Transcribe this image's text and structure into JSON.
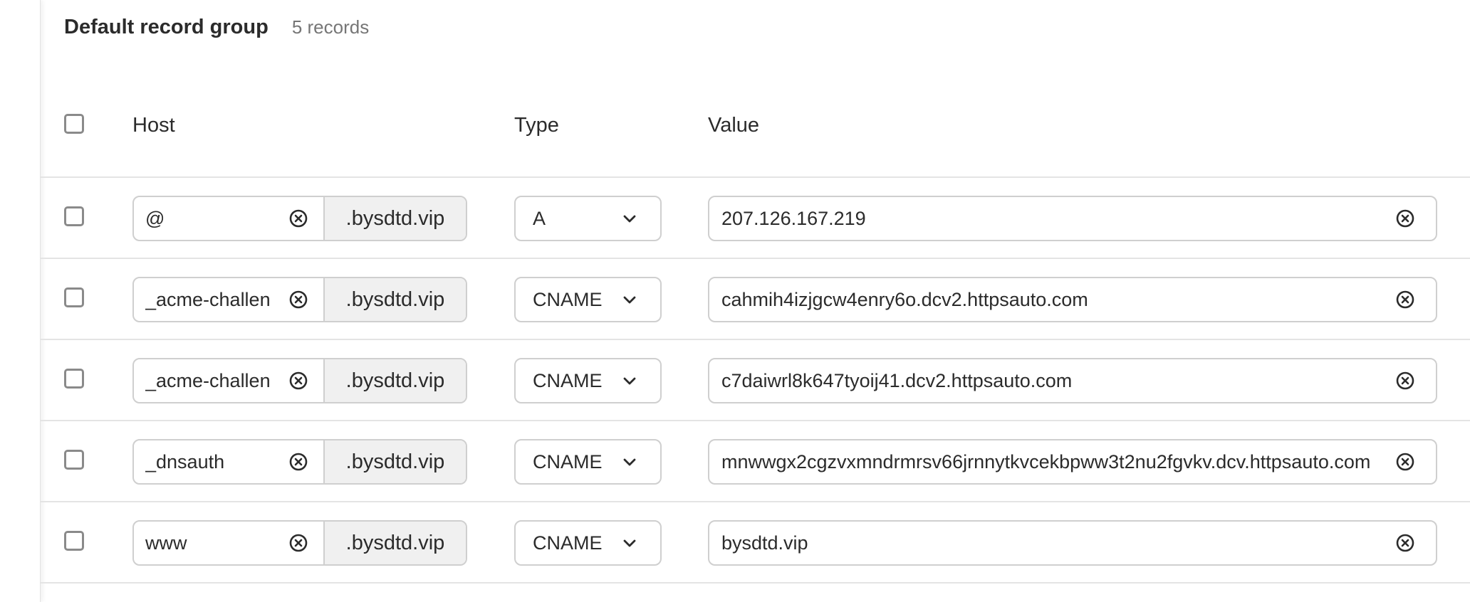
{
  "group": {
    "title": "Default record group",
    "count": "5 records"
  },
  "columns": {
    "host": "Host",
    "type": "Type",
    "value": "Value"
  },
  "icons": {
    "clear": "clear-circle-x-icon",
    "dropdown": "chevron-down-icon"
  },
  "records": [
    {
      "host": "@",
      "suffix": ".bysdtd.vip",
      "type": "A",
      "value": "207.126.167.219"
    },
    {
      "host": "_acme-challenge",
      "suffix": ".bysdtd.vip",
      "type": "CNAME",
      "value": "cahmih4izjgcw4enry6o.dcv2.httpsauto.com"
    },
    {
      "host": "_acme-challenge",
      "suffix": ".bysdtd.vip",
      "type": "CNAME",
      "value": "c7daiwrl8k647tyoij41.dcv2.httpsauto.com"
    },
    {
      "host": "_dnsauth",
      "suffix": ".bysdtd.vip",
      "type": "CNAME",
      "value": "mnwwgx2cgzvxmndrmrsv66jrnnytkvcekbpww3t2nu2fgvkv.dcv.httpsauto.com"
    },
    {
      "host": "www",
      "suffix": ".bysdtd.vip",
      "type": "CNAME",
      "value": "bysdtd.vip"
    }
  ]
}
